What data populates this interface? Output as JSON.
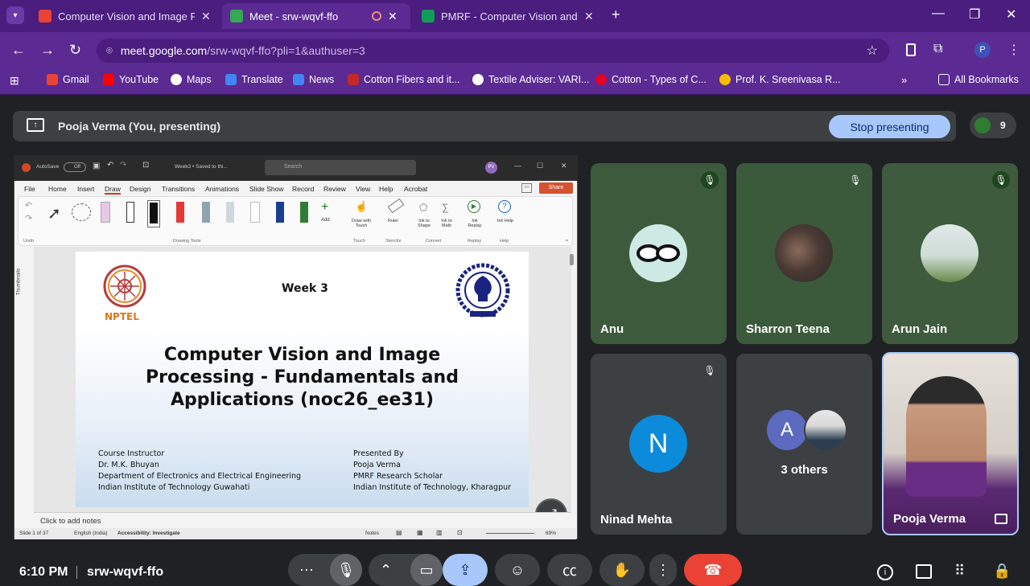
{
  "browser": {
    "tabs": [
      {
        "label": "Computer Vision and Image Pr",
        "active": false
      },
      {
        "label": "Meet - srw-wqvf-ffo",
        "active": true
      },
      {
        "label": "PMRF - Computer Vision and Im",
        "active": false
      }
    ],
    "url_host": "meet.google.com",
    "url_path": "/srw-wqvf-ffo?pli=1&authuser=3",
    "profile_initial": "P",
    "bookmarks": [
      {
        "label": "Gmail",
        "icon": "gmail-icon",
        "color": "#ea4335"
      },
      {
        "label": "YouTube",
        "icon": "youtube-icon",
        "color": "#ff0000"
      },
      {
        "label": "Maps",
        "icon": "google-icon",
        "color": "#4285f4"
      },
      {
        "label": "Translate",
        "icon": "translate-icon",
        "color": "#4285f4"
      },
      {
        "label": "News",
        "icon": "news-icon",
        "color": "#4285f4"
      },
      {
        "label": "Cotton Fibers and it...",
        "icon": "t-icon",
        "color": "#c62828"
      },
      {
        "label": "Textile Adviser: VARI...",
        "icon": "globe-icon",
        "color": "#ffffff"
      },
      {
        "label": "Cotton - Types of C...",
        "icon": "pinterest-icon",
        "color": "#e60023"
      },
      {
        "label": "Prof. K. Sreenivasa R...",
        "icon": "star-icon",
        "color": "#fbbc04"
      }
    ],
    "all_bookmarks": "All Bookmarks"
  },
  "meet": {
    "presenting_label": "Pooja Verma (You, presenting)",
    "stop_button": "Stop presenting",
    "participant_count": "9",
    "time": "6:10 PM",
    "meeting_code": "srw-wqvf-ffo"
  },
  "ppt": {
    "autosave": "AutoSave",
    "autosave_state": "Off",
    "doc_title": "Week3 • Saved to thi...",
    "search_placeholder": "Search",
    "user_initials": "PV",
    "share": "Share",
    "ribbon_tabs": [
      "File",
      "Home",
      "Insert",
      "Draw",
      "Design",
      "Transitions",
      "Animations",
      "Slide Show",
      "Record",
      "Review",
      "View",
      "Help",
      "Acrobat"
    ],
    "active_tab": "Draw",
    "groups": {
      "undo": "Undo",
      "drawing_tools": "Drawing Tools",
      "add": "Add",
      "touch_btn": "Draw with Touch",
      "touch": "Touch",
      "ruler": "Ruler",
      "stencils": "Stencils",
      "ink_shape": "Ink to Shape",
      "ink_math": "Ink to Math",
      "convert": "Convert",
      "ink_replay": "Ink Replay",
      "replay": "Replay",
      "ink_help": "Ink Help",
      "help": "Help"
    },
    "thumbnails": "Thumbnails",
    "notes_placeholder": "Click to add notes",
    "status": {
      "slide": "Slide 1 of 37",
      "lang": "English (India)",
      "accessibility": "Accessibility: Investigate",
      "notes": "Notes",
      "zoom": "69%"
    }
  },
  "slide": {
    "nptel": "NPTEL",
    "week": "Week 3",
    "title": [
      "Computer Vision and Image",
      "Processing - Fundamentals and",
      "Applications (noc26_ee31)"
    ],
    "instructor": [
      "Course Instructor",
      "Dr. M.K. Bhuyan",
      "Department of Electronics and Electrical Engineering",
      "Indian Institute of Technology Guwahati"
    ],
    "presenter": [
      "Presented By",
      "Pooja Verma",
      "PMRF Research Scholar",
      "Indian Institute of Technology, Kharagpur"
    ]
  },
  "participants": [
    {
      "name": "Anu",
      "bg": "#3e5a3d",
      "muted": true
    },
    {
      "name": "Sharron Teena",
      "bg": "#3b5a3c",
      "muted": true
    },
    {
      "name": "Arun Jain",
      "bg": "#3f5b3d",
      "muted": true
    },
    {
      "name": "Ninad Mehta",
      "initial": "N",
      "bg": "#3c4043",
      "avatar_color": "#0b8bd9",
      "muted": true
    },
    {
      "name": "3 others",
      "initial": "A",
      "bg": "#3c4043",
      "avatar_color": "#5c6bc0"
    },
    {
      "name": "Pooja Verma",
      "bg": "#d9d4cf"
    }
  ],
  "colors": {
    "end_call": "#ea4335",
    "present_active": "#a8c7fa",
    "mic_muted_green": "#1e4620"
  }
}
